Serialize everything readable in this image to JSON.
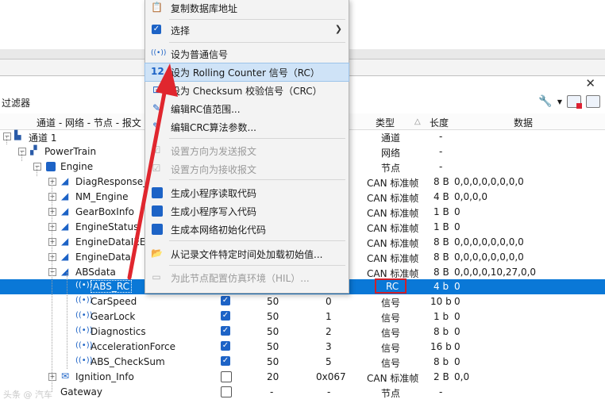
{
  "panel": {
    "close_symbol": "✕",
    "filter_label": "过滤器"
  },
  "headers": {
    "col_tree": "通道 - 网络 - 节点 - 报文",
    "col_type": "类型",
    "col_len": "长度",
    "col_data": "数据",
    "sort_indicator": "△"
  },
  "tree": {
    "channel1": "通道 1",
    "powertrain": "PowerTrain",
    "engine": "Engine",
    "messages": [
      {
        "name": "DiagResponse_M",
        "type": "CAN 标准帧",
        "len": "8 B",
        "data": "0,0,0,0,0,0,0,0"
      },
      {
        "name": "NM_Engine",
        "type": "CAN 标准帧",
        "len": "4 B",
        "data": "0,0,0,0"
      },
      {
        "name": "GearBoxInfo",
        "type": "CAN 标准帧",
        "len": "1 B",
        "data": "0"
      },
      {
        "name": "EngineStatus",
        "type": "CAN 标准帧",
        "len": "1 B",
        "data": "0"
      },
      {
        "name": "EngineDataIEEE",
        "type": "CAN 标准帧",
        "len": "8 B",
        "data": "0,0,0,0,0,0,0,0"
      },
      {
        "name": "EngineData",
        "type": "CAN 标准帧",
        "len": "8 B",
        "data": "0,0,0,0,0,0,0,0"
      },
      {
        "name": "ABSdata",
        "type": "CAN 标准帧",
        "len": "8 B",
        "data": "0,0,0,0,10,27,0,0"
      }
    ],
    "channel_row": {
      "type": "通道",
      "len": "-"
    },
    "network_row": {
      "type": "网络",
      "len": "-"
    },
    "node_row": {
      "type": "节点",
      "len": "-"
    },
    "signals": [
      {
        "name": "ABS_RC",
        "type": "RC",
        "len": "4 b",
        "data": "0"
      },
      {
        "name": "CarSpeed",
        "c1": "50",
        "c2": "0",
        "type": "信号",
        "len": "10 b",
        "data": "0"
      },
      {
        "name": "GearLock",
        "c1": "50",
        "c2": "1",
        "type": "信号",
        "len": "1 b",
        "data": "0"
      },
      {
        "name": "Diagnostics",
        "c1": "50",
        "c2": "2",
        "type": "信号",
        "len": "8 b",
        "data": "0"
      },
      {
        "name": "AccelerationForce",
        "c1": "50",
        "c2": "3",
        "type": "信号",
        "len": "16 b",
        "data": "0"
      },
      {
        "name": "ABS_CheckSum",
        "c1": "50",
        "c2": "5",
        "type": "信号",
        "len": "8 b",
        "data": "0"
      }
    ],
    "ignition": {
      "name": "Ignition_Info",
      "c1": "20",
      "c2": "0x067",
      "type": "CAN 标准帧",
      "len": "2 B",
      "data": "0,0"
    },
    "gateway": {
      "name": "Gateway",
      "c1": "-",
      "c2": "-",
      "type": "节点",
      "len": "-"
    }
  },
  "menu": {
    "copy_db": "复制数据库地址",
    "select": "选择",
    "set_normal": "设为普通信号",
    "set_rc": "设为 Rolling Counter 信号（RC）",
    "set_rc_icon": "12",
    "set_crc": "设为 Checksum 校验信号（CRC）",
    "edit_rc": "编辑RC值范围...",
    "edit_crc": "编辑CRC算法参数...",
    "set_send": "设置方向为发送报文",
    "set_recv": "设置方向为接收报文",
    "gen_read": "生成小程序读取代码",
    "gen_write": "生成小程序写入代码",
    "gen_init": "生成本网络初始化代码",
    "load_init": "从记录文件特定时间处加载初始值...",
    "hil": "为此节点配置仿真环境（HIL）..."
  },
  "icons": [
    "close-icon",
    "wrench-icon",
    "filter-clear-icon",
    "export-icon",
    "copy-icon",
    "checkbox-icon",
    "signal-icon",
    "twelve-icon",
    "crc-icon",
    "edit-icon",
    "c-code-icon",
    "load-icon"
  ],
  "watermark": "头条 @ 汽车"
}
